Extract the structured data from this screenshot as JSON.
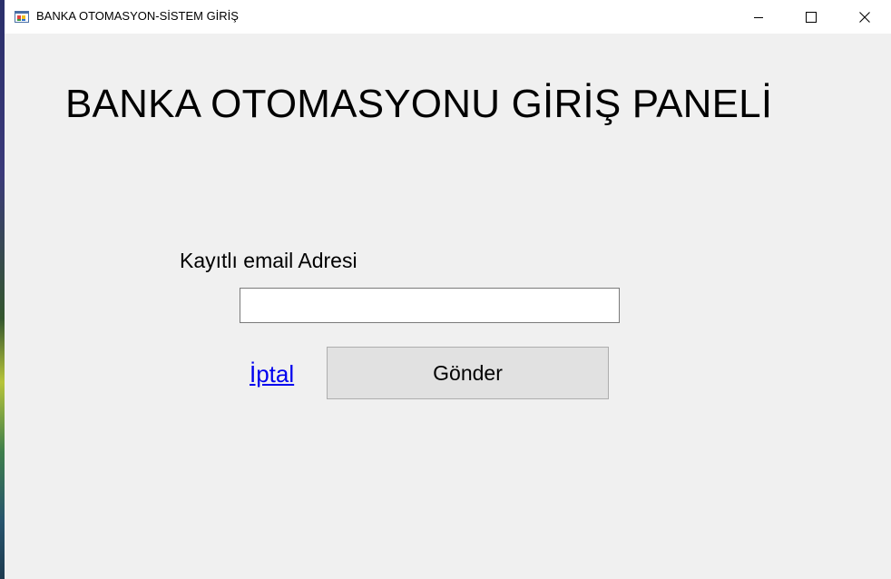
{
  "window": {
    "title": "BANKA OTOMASYON-SİSTEM GİRİŞ",
    "icon": "windows-form-icon",
    "controls": {
      "minimize_icon": "minimize-icon",
      "maximize_icon": "maximize-icon",
      "close_icon": "close-icon"
    }
  },
  "form": {
    "heading": "BANKA OTOMASYONU GİRİŞ PANELİ",
    "email_label": "Kayıtlı email Adresi",
    "email_value": "",
    "cancel_link": "İptal",
    "submit_label": "Gönder"
  },
  "colors": {
    "form_background": "#f0f0f0",
    "link": "#0000ee",
    "button_background": "#e1e1e1"
  }
}
